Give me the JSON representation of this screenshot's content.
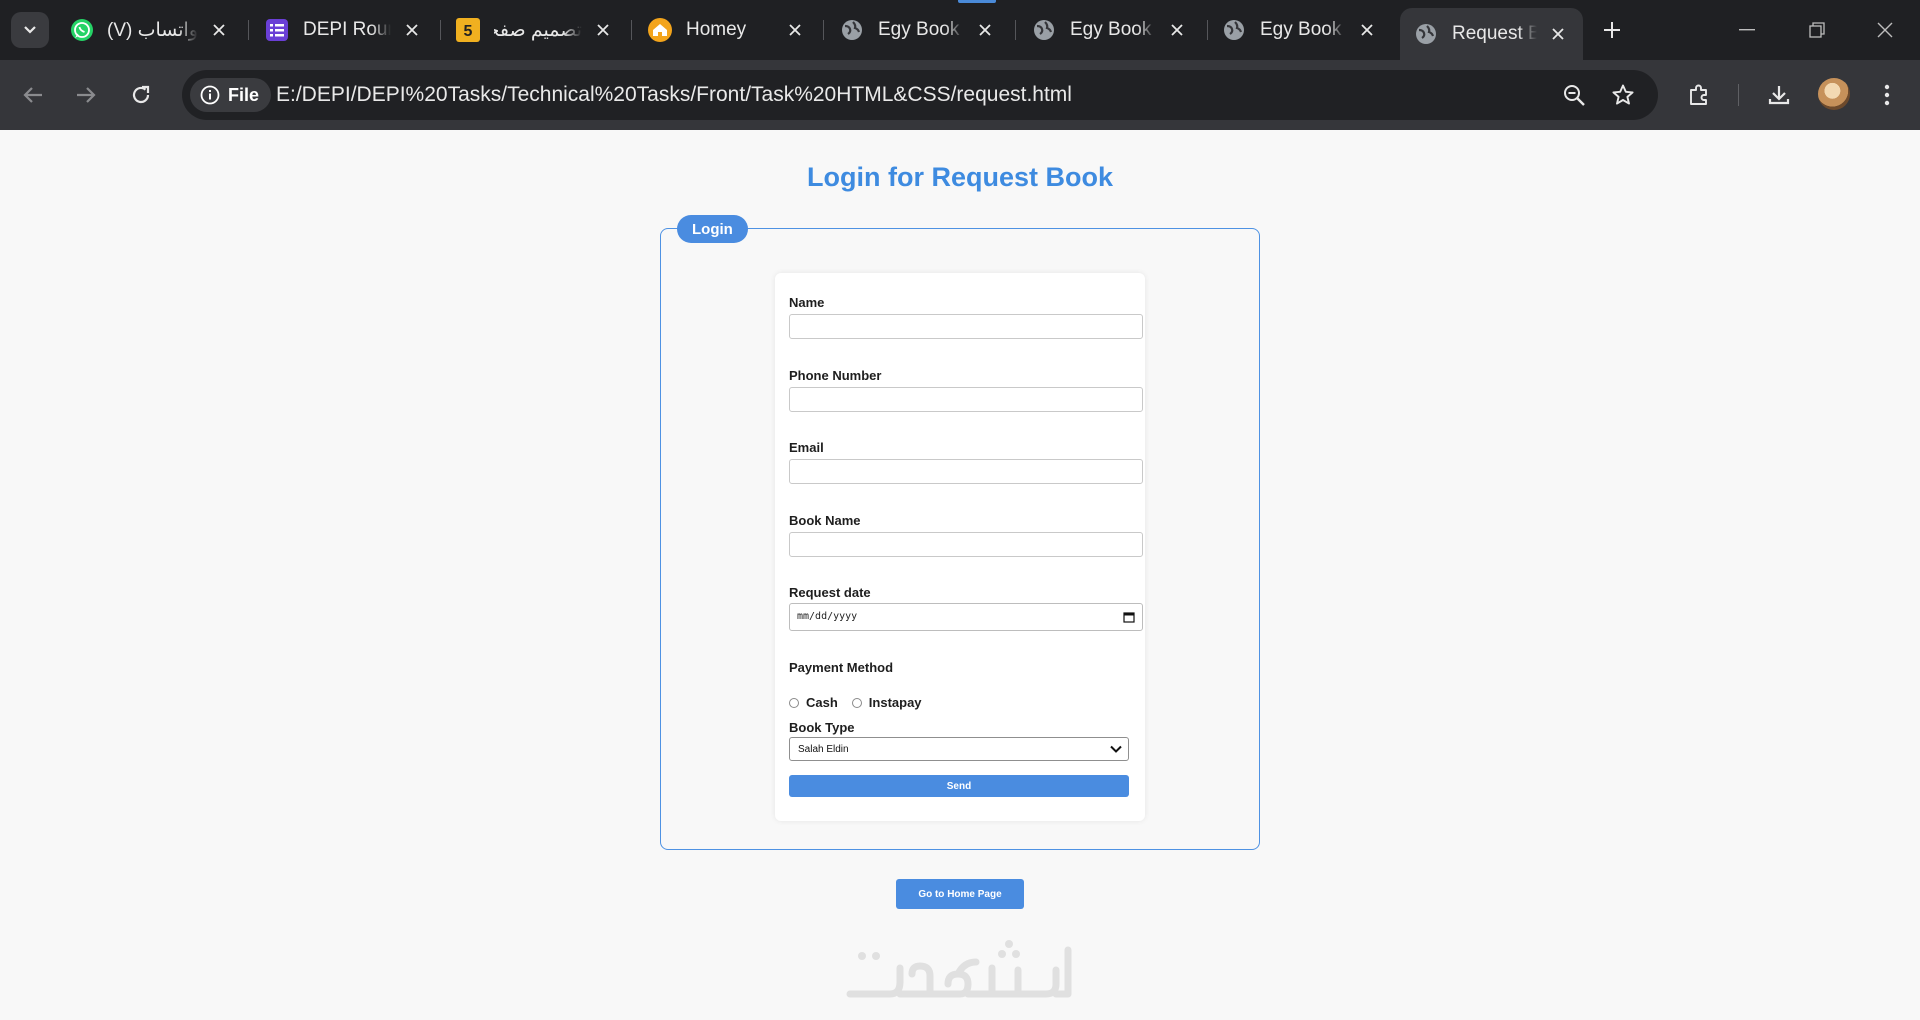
{
  "browser": {
    "tabs": [
      {
        "title": "واتساب (V)",
        "icon": "whatsapp-icon"
      },
      {
        "title": "DEPI Round",
        "icon": "list-icon"
      },
      {
        "title": "تصميم صفحة",
        "icon": "khamsat-icon",
        "badge": "5"
      },
      {
        "title": "Homey",
        "icon": "home-icon"
      },
      {
        "title": "Egy Book s",
        "icon": "globe-icon"
      },
      {
        "title": "Egy Book s",
        "icon": "globe-icon"
      },
      {
        "title": "Egy Book s",
        "icon": "globe-icon"
      },
      {
        "title": "Request Bo",
        "icon": "globe-icon",
        "active": true
      }
    ],
    "site_chip": "File",
    "url": "E:/DEPI/DEPI%20Tasks/Technical%20Tasks/Front/Task%20HTML&CSS/request.html"
  },
  "page": {
    "title": "Login for Request Book",
    "legend": "Login",
    "fields": {
      "name_label": "Name",
      "phone_label": "Phone Number",
      "email_label": "Email",
      "book_name_label": "Book Name",
      "date_label": "Request date",
      "date_placeholder": "mm/dd/yyyy",
      "payment_label": "Payment Method",
      "payment_options": [
        "Cash",
        "Instapay"
      ],
      "book_type_label": "Book Type",
      "book_type_value": "Salah Eldin"
    },
    "send_label": "Send",
    "home_label": "Go to Home Page",
    "watermark": "خمسات"
  },
  "colors": {
    "accent": "#4a8ce0",
    "heading": "#3e8be0",
    "tabstrip": "#1f2023",
    "toolbar": "#35363a"
  }
}
